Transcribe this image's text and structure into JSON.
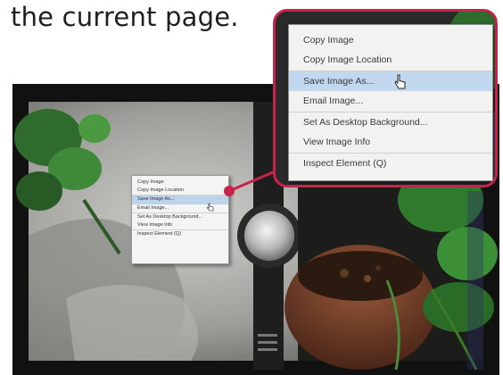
{
  "caption": "the current page.",
  "context_menu": {
    "items": [
      {
        "label": "Copy Image"
      },
      {
        "label": "Copy Image Location"
      },
      {
        "label": "Save Image As...",
        "selected": true
      },
      {
        "label": "Email Image..."
      },
      {
        "label": "Set As Desktop Background..."
      },
      {
        "label": "View Image Info"
      },
      {
        "label": "Inspect Element (Q)"
      }
    ]
  },
  "icons": {
    "cursor": "pointer-hand-icon",
    "shortcut": "keyboard-shortcut-icon"
  },
  "colors": {
    "callout_border": "#c8234a",
    "selection": "#c2d8ef",
    "menu_bg": "#f2f2f0"
  }
}
